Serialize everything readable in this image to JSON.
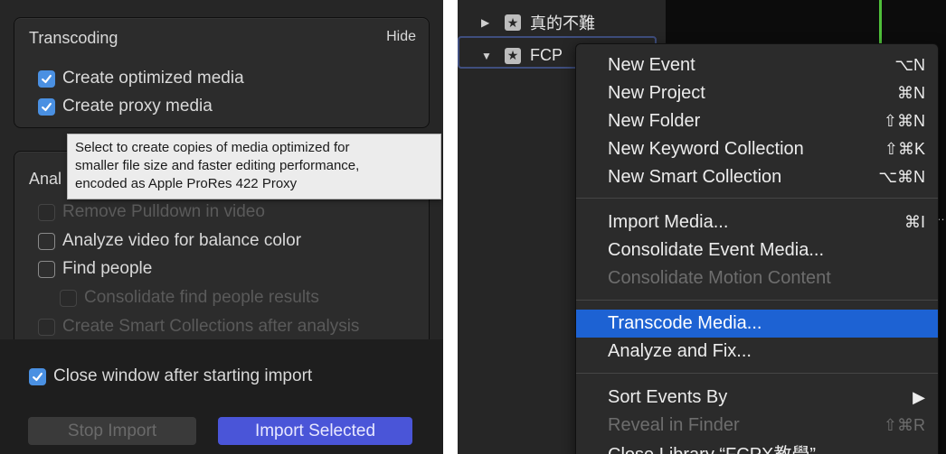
{
  "left_panel": {
    "transcoding": {
      "title": "Transcoding",
      "hide_label": "Hide",
      "options": [
        {
          "label": "Create optimized media",
          "checked": true
        },
        {
          "label": "Create proxy media",
          "checked": true
        }
      ]
    },
    "tooltip": {
      "line1": "Select to create copies of media optimized for",
      "line2": "smaller file size and faster editing performance,",
      "line3": "encoded as Apple ProRes 422 Proxy"
    },
    "analysis": {
      "title_partial": "Anal",
      "options": [
        {
          "label": "Remove Pulldown in video",
          "checked": false,
          "disabled": true
        },
        {
          "label": "Analyze video for balance color",
          "checked": false,
          "disabled": false
        },
        {
          "label": "Find people",
          "checked": false,
          "disabled": false
        },
        {
          "label": "Consolidate find people results",
          "checked": false,
          "disabled": true
        },
        {
          "label": "Create Smart Collections after analysis",
          "checked": false,
          "disabled": true
        }
      ]
    },
    "close_window": {
      "label": "Close window after starting import",
      "checked": true
    },
    "buttons": {
      "stop": "Stop Import",
      "import": "Import Selected"
    }
  },
  "right_panel": {
    "library_rows": [
      {
        "label": "真的不難",
        "expanded": false
      },
      {
        "label": "FCP",
        "expanded": true
      }
    ],
    "menu": [
      {
        "label": "New Event",
        "shortcut": "⌥N",
        "disabled": false
      },
      {
        "label": "New Project",
        "shortcut": "⌘N",
        "disabled": false
      },
      {
        "label": "New Folder",
        "shortcut": "⇧⌘N",
        "disabled": false
      },
      {
        "label": "New Keyword Collection",
        "shortcut": "⇧⌘K",
        "disabled": false
      },
      {
        "label": "New Smart Collection",
        "shortcut": "⌥⌘N",
        "disabled": false
      },
      {
        "label": "Import Media...",
        "shortcut": "⌘I",
        "disabled": false
      },
      {
        "label": "Consolidate Event Media...",
        "shortcut": "",
        "disabled": false
      },
      {
        "label": "Consolidate Motion Content",
        "shortcut": "",
        "disabled": true
      },
      {
        "label": "Transcode Media...",
        "shortcut": "",
        "disabled": false,
        "highlighted": true
      },
      {
        "label": "Analyze and Fix...",
        "shortcut": "",
        "disabled": false
      },
      {
        "label": "Sort Events By",
        "shortcut": "▶",
        "disabled": false
      },
      {
        "label": "Reveal in Finder",
        "shortcut": "⇧⌘R",
        "disabled": true
      },
      {
        "label": "Close Library “FCPX教學”",
        "shortcut": "",
        "disabled": false
      }
    ],
    "accent_color": "#1d62d3"
  }
}
